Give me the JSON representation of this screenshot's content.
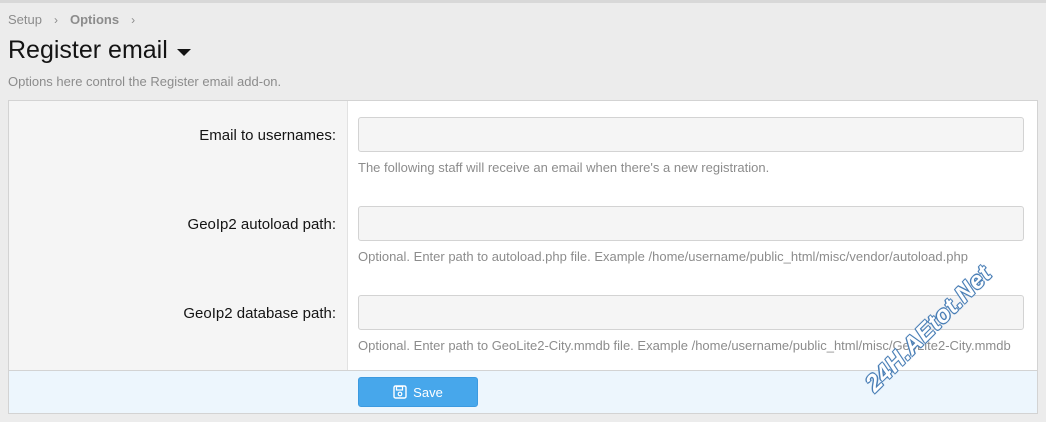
{
  "breadcrumb": {
    "items": [
      {
        "label": "Setup"
      },
      {
        "label": "Options"
      }
    ]
  },
  "header": {
    "title": "Register email",
    "description": "Options here control the Register email add-on."
  },
  "form": {
    "fields": [
      {
        "label": "Email to usernames:",
        "value": "",
        "hint": "The following staff will receive an email when there's a new registration."
      },
      {
        "label": "GeoIp2 autoload path:",
        "value": "",
        "hint": "Optional. Enter path to autoload.php file. Example /home/username/public_html/misc/vendor/autoload.php"
      },
      {
        "label": "GeoIp2 database path:",
        "value": "",
        "hint": "Optional. Enter path to GeoLite2-City.mmdb file. Example /home/username/public_html/misc/GeoLite2-City.mmdb"
      }
    ],
    "save_label": "Save"
  },
  "watermark": "24H.AEtot.Net",
  "colors": {
    "accent": "#47a7eb",
    "footer_bg": "#edf6fd",
    "label_bg": "#f5f5f5"
  }
}
